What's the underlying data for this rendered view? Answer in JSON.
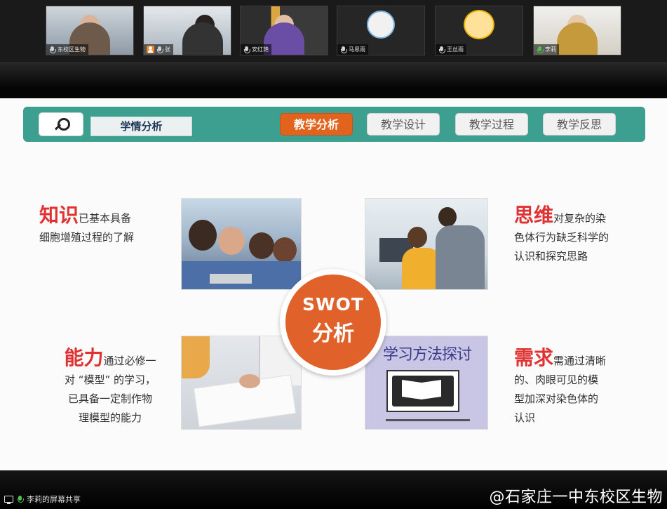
{
  "participants": [
    {
      "name": "东校区生物"
    },
    {
      "name": "张"
    },
    {
      "name": "安红艳"
    },
    {
      "name": "马思雨"
    },
    {
      "name": "王丝雨"
    },
    {
      "name": "李莉"
    }
  ],
  "slide": {
    "nav": {
      "search_label": "学情分析",
      "tabs": [
        "教学分析",
        "教学设计",
        "教学过程",
        "教学反思"
      ],
      "active_tab": "教学分析"
    },
    "quadrants": {
      "knowledge": {
        "keyword": "知识",
        "lead": "已基本具备",
        "rest": "细胞增殖过程的了解"
      },
      "thinking": {
        "keyword": "思维",
        "lead": "对复杂的染",
        "line2": "色体行为缺乏科学的",
        "line3": "认识和探究思路"
      },
      "ability": {
        "keyword": "能力",
        "lead": "通过必修一",
        "line2": "对 “模型” 的学习，",
        "line3": "已具备一定制作物",
        "line4": "理模型的能力"
      },
      "demand": {
        "keyword": "需求",
        "lead": "需通过清晰",
        "line2": "的、肉眼可见的模",
        "line3": "型加深对染色体的",
        "line4": "认识"
      }
    },
    "swot": {
      "line1": "SWOT",
      "line2": "分析"
    },
    "book_image": {
      "title": "学习方法探讨"
    }
  },
  "status_bar": {
    "share_text": "李莉的屏幕共享",
    "watermark": "@石家庄一中东校区生物"
  },
  "colors": {
    "nav_bg": "#3c9f8f",
    "active_tab": "#e2631e",
    "keyword_red": "#e03232",
    "swot_orange": "#e0612a"
  }
}
